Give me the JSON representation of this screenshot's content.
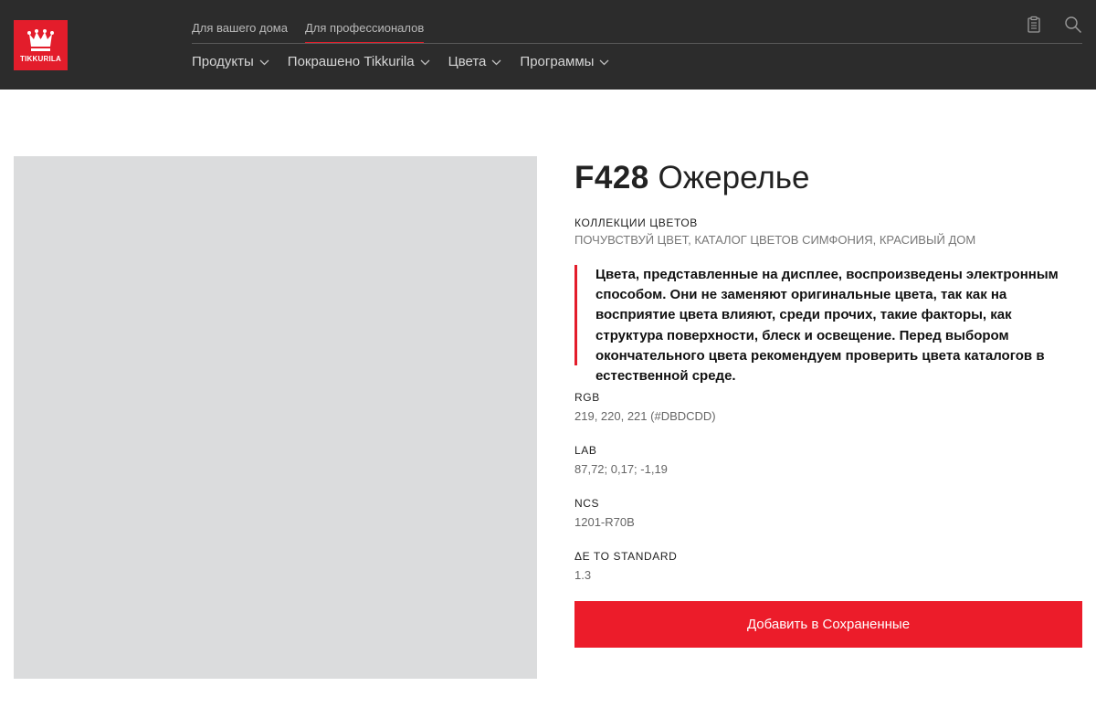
{
  "header": {
    "logo_text": "TIKKURILA",
    "top_nav": [
      {
        "label": "Для вашего дома",
        "active": false
      },
      {
        "label": "Для профессионалов",
        "active": true
      }
    ],
    "main_nav": [
      {
        "label": "Продукты"
      },
      {
        "label": "Покрашено Tikkurila"
      },
      {
        "label": "Цвета"
      },
      {
        "label": "Программы"
      }
    ],
    "icons": [
      "clipboard-icon",
      "search-icon"
    ]
  },
  "color": {
    "code": "F428",
    "name": "Ожерелье",
    "swatch_hex": "#DBDCDD",
    "collections_label": "КОЛЛЕКЦИИ ЦВЕТОВ",
    "collections_value": "ПОЧУВСТВУЙ ЦВЕТ, КАТАЛОГ ЦВЕТОВ СИМФОНИЯ, КРАСИВЫЙ ДОМ",
    "disclaimer": "Цвета, представленные на дисплее, воспроизведены электронным способом. Они не заменяют оригинальные цвета, так как на восприятие цвета влияют, среди прочих, такие факторы, как структура поверхности, блеск и освещение. Перед выбором окончательного цвета рекомендуем проверить цвета каталогов в естественной среде.",
    "properties": [
      {
        "label": "RGB",
        "value": "219, 220, 221 (#DBDCDD)"
      },
      {
        "label": "LAB",
        "value": "87,72; 0,17; -1,19"
      },
      {
        "label": "NCS",
        "value": "1201-R70B"
      },
      {
        "label": "ΔE TO STANDARD",
        "value": "1.3"
      }
    ],
    "save_button": "Добавить в Сохраненные"
  },
  "colors": {
    "brand_red": "#e31d2b",
    "header_bg": "#2c2c2c"
  }
}
